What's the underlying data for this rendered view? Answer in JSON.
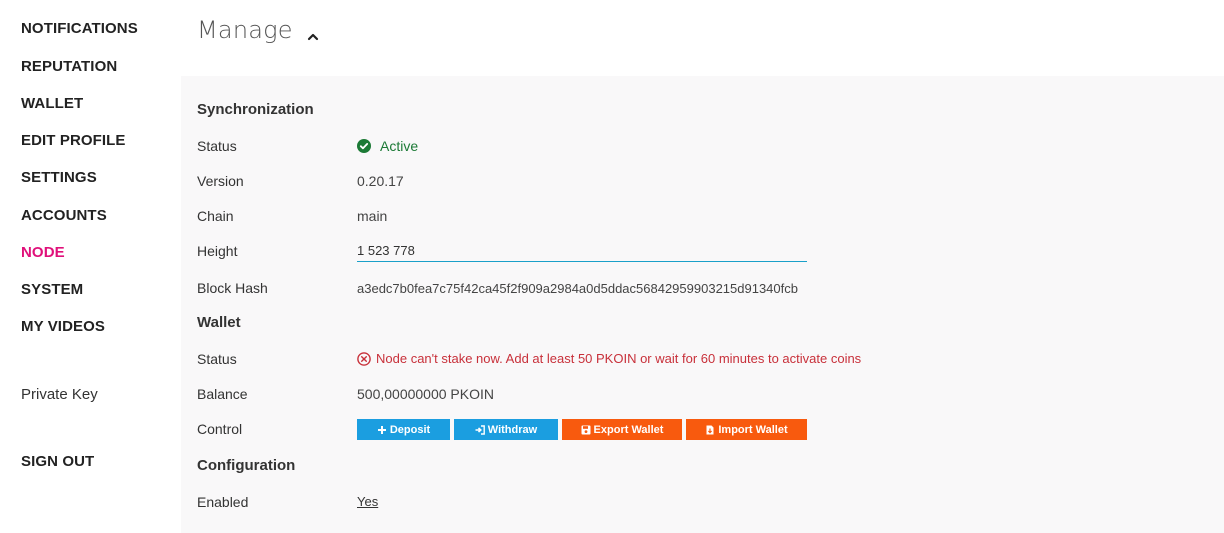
{
  "sidebar": {
    "items": [
      {
        "label": "NOTIFICATIONS"
      },
      {
        "label": "REPUTATION"
      },
      {
        "label": "WALLET"
      },
      {
        "label": "EDIT PROFILE"
      },
      {
        "label": "SETTINGS"
      },
      {
        "label": "ACCOUNTS"
      },
      {
        "label": "NODE",
        "active": true
      },
      {
        "label": "SYSTEM"
      },
      {
        "label": "MY VIDEOS"
      }
    ],
    "private_key": "Private Key",
    "sign_out": "SIGN OUT"
  },
  "header": {
    "title": "Manage",
    "chevron_icon": "chevron-up-icon"
  },
  "synchronization": {
    "title": "Synchronization",
    "status_label": "Status",
    "status_value": "Active",
    "status_icon": "check-circle-icon",
    "version_label": "Version",
    "version_value": "0.20.17",
    "chain_label": "Chain",
    "chain_value": "main",
    "height_label": "Height",
    "height_value": "1 523 778",
    "blockhash_label": "Block Hash",
    "blockhash_value": "a3edc7b0fea7c75f42ca45f2f909a2984a0d5ddac56842959903215d91340fcb"
  },
  "wallet": {
    "title": "Wallet",
    "status_label": "Status",
    "status_value": "Node can't stake now. Add at least 50 PKOIN or wait for 60 minutes to activate coins",
    "status_icon": "x-circle-icon",
    "balance_label": "Balance",
    "balance_value": "500,00000000 PKOIN",
    "control_label": "Control",
    "buttons": {
      "deposit": "Deposit",
      "withdraw": "Withdraw",
      "export": "Export Wallet",
      "import": "Import Wallet"
    }
  },
  "configuration": {
    "title": "Configuration",
    "enabled_label": "Enabled",
    "enabled_value": "Yes"
  },
  "colors": {
    "active_nav": "#e0107a",
    "success": "#1c7a36",
    "error": "#c8303a",
    "blue_button": "#1b9ee0",
    "orange_button": "#f85a0e",
    "input_underline": "#1aa0c9"
  }
}
